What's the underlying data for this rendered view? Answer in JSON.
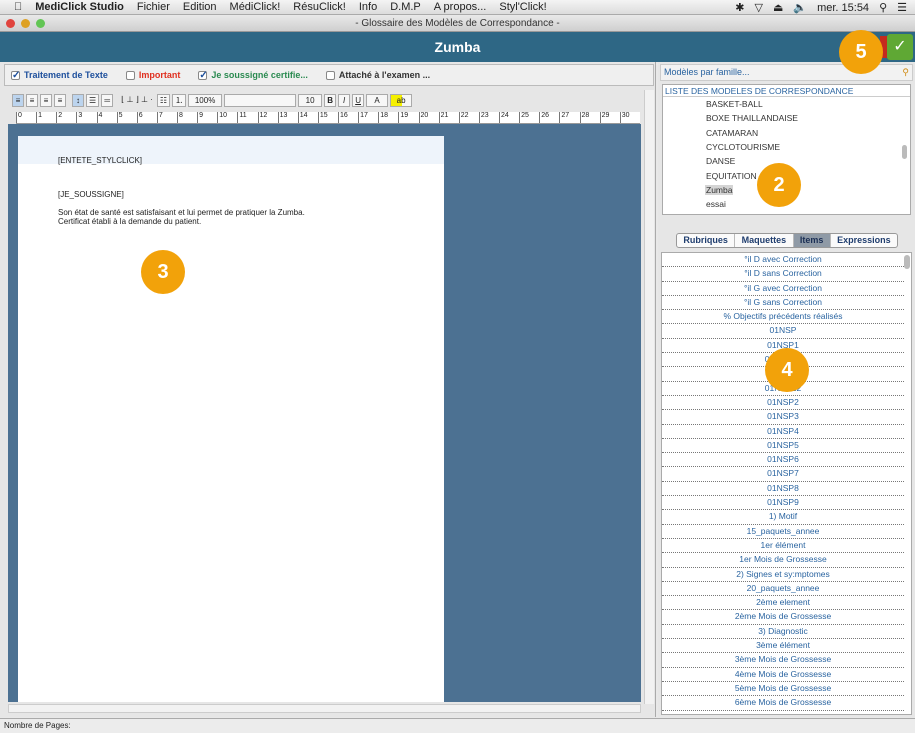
{
  "menubar": {
    "app": "MediClick Studio",
    "items": [
      "Fichier",
      "Edition",
      "MédiClick!",
      "RésuClick!",
      "Info",
      "D.M.P",
      "A propos...",
      "Styl'Click!"
    ],
    "clock": "mer. 15:54"
  },
  "window": {
    "title": "- Glossaire des Modèles de Correspondance -"
  },
  "header": {
    "title": "Zumba"
  },
  "checks": [
    {
      "label": "Traitement de Texte",
      "checked": true,
      "color": "#1d4f9c"
    },
    {
      "label": "Important",
      "checked": false,
      "color": "#e03020"
    },
    {
      "label": "Je soussigné certifie...",
      "checked": true,
      "color": "#2a8a50"
    },
    {
      "label": "Attaché à l'examen ...",
      "checked": false,
      "color": "#333333"
    }
  ],
  "toolbar": {
    "zoom": "100%",
    "font": "",
    "size": "10",
    "bold": "B",
    "italic": "I",
    "underline": "U",
    "color": "A",
    "highlight": "ab"
  },
  "ruler": [
    "0",
    "1",
    "2",
    "3",
    "4",
    "5",
    "6",
    "7",
    "8",
    "9",
    "10",
    "11",
    "12",
    "13",
    "14",
    "15",
    "16",
    "17",
    "18",
    "19",
    "20",
    "21",
    "22",
    "23",
    "24",
    "25",
    "26",
    "27",
    "28",
    "29",
    "30"
  ],
  "document": {
    "header": "[ENTETE_STYLCLICK]",
    "line1": "[JE_SOUSSIGNE]",
    "line2": "Son état de santé est satisfaisant et lui permet de pratiquer la Zumba.",
    "line3": "Certificat établi à la demande du patient."
  },
  "search": {
    "placeholder": "Modèles par famille..."
  },
  "models": {
    "header": "LISTE DES MODELES DE CORRESPONDANCE",
    "items": [
      "BASKET-BALL",
      "BOXE THAILLANDAISE",
      "CATAMARAN",
      "CYCLOTOURISME",
      "DANSE",
      "EQUITATION",
      "Zumba",
      "essai"
    ],
    "selected": "Zumba"
  },
  "tabs": [
    "Rubriques",
    "Maquettes",
    "Items",
    "Expressions"
  ],
  "active_tab": "Items",
  "items": [
    "°il D avec Correction",
    "°il D sans Correction",
    "°il G avec Correction",
    "°il G sans Correction",
    "% Objectifs précédents réalisés",
    "01NSP",
    "01NSP1",
    "01NSP10",
    "01NSP11",
    "01NSP12",
    "01NSP2",
    "01NSP3",
    "01NSP4",
    "01NSP5",
    "01NSP6",
    "01NSP7",
    "01NSP8",
    "01NSP9",
    "1) Motif",
    "15_paquets_annee",
    "1er élément",
    "1er Mois de Grossesse",
    "2) Signes et sy:mptomes",
    "20_paquets_annee",
    "2ème element",
    "2ème Mois de Grossesse",
    "3) Diagnostic",
    "3ème élément",
    "3ème Mois de Grossesse",
    "4ème Mois de Grossesse",
    "5ème Mois de Grossesse",
    "6ème Mois de Grossesse"
  ],
  "status": {
    "pages_label": "Nombre de Pages:"
  },
  "badges": [
    "5",
    "2",
    "3",
    "4"
  ],
  "colors": {
    "header": "#2e6785",
    "badge": "#f2a20a",
    "item_text": "#2a64a0"
  }
}
